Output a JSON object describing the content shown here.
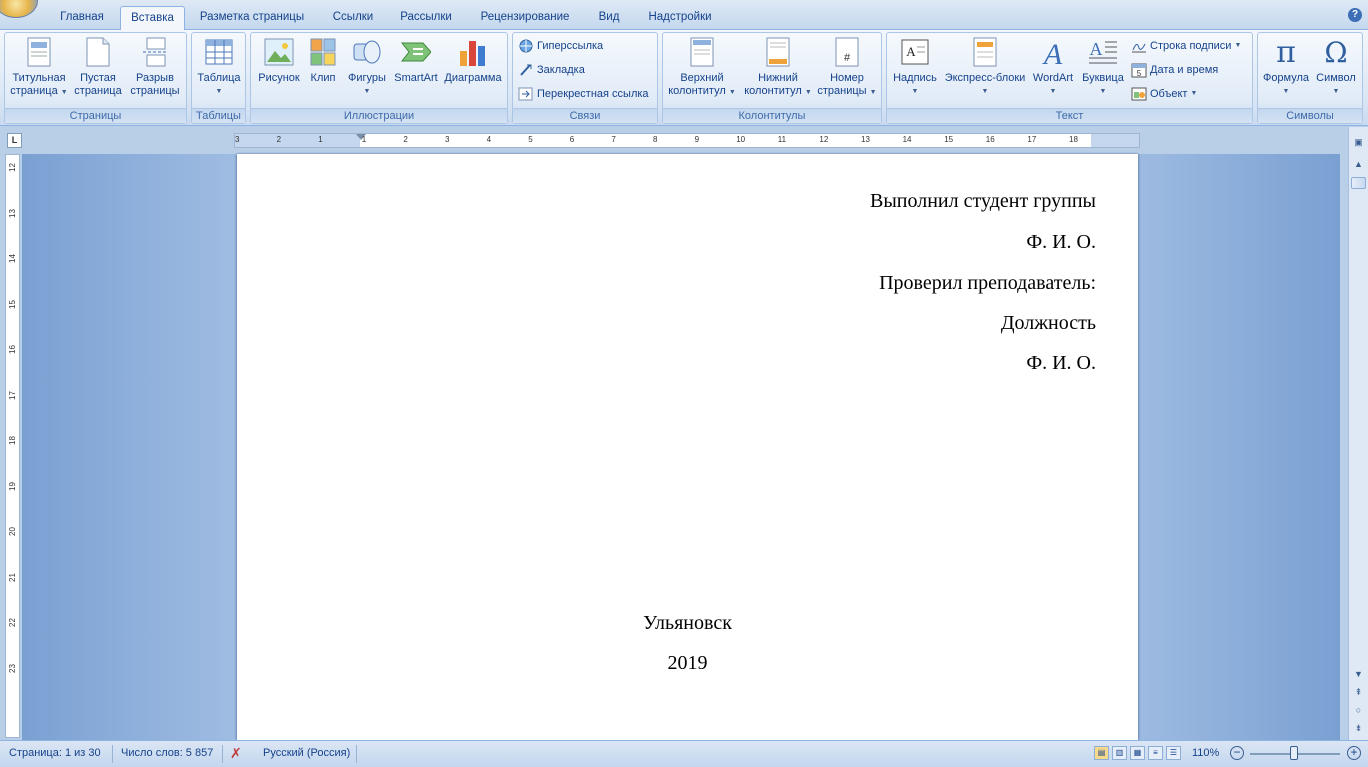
{
  "tabs": [
    "Главная",
    "Вставка",
    "Разметка страницы",
    "Ссылки",
    "Рассылки",
    "Рецензирование",
    "Вид",
    "Надстройки"
  ],
  "active_tab": "Вставка",
  "ribbon": {
    "pages": {
      "label": "Страницы",
      "cover": [
        "Титульная",
        "страница"
      ],
      "blank": [
        "Пустая",
        "страница"
      ],
      "break": [
        "Разрыв",
        "страницы"
      ]
    },
    "tables": {
      "label": "Таблицы",
      "table": "Таблица"
    },
    "illustrations": {
      "label": "Иллюстрации",
      "picture": "Рисунок",
      "clip": "Клип",
      "shapes": "Фигуры",
      "smartart": "SmartArt",
      "chart": "Диаграмма"
    },
    "links": {
      "label": "Связи",
      "hyperlink": "Гиперссылка",
      "bookmark": "Закладка",
      "crossref": "Перекрестная ссылка"
    },
    "headerfooter": {
      "label": "Колонтитулы",
      "header": [
        "Верхний",
        "колонтитул"
      ],
      "footer": [
        "Нижний",
        "колонтитул"
      ],
      "pagenum": [
        "Номер",
        "страницы"
      ]
    },
    "text": {
      "label": "Текст",
      "textbox": "Надпись",
      "quickparts": "Экспресс-блоки",
      "wordart": "WordArt",
      "dropcap": "Буквица",
      "signature": "Строка подписи",
      "datetime": "Дата и время",
      "object": "Объект"
    },
    "symbols": {
      "label": "Символы",
      "equation": "Формула",
      "symbol": "Символ"
    }
  },
  "ruler": {
    "h": [
      "3",
      "2",
      "1",
      "1",
      "2",
      "3",
      "4",
      "5",
      "6",
      "7",
      "8",
      "9",
      "10",
      "11",
      "12",
      "13",
      "14",
      "15",
      "16",
      "17",
      "18"
    ],
    "v": [
      "12",
      "13",
      "14",
      "15",
      "16",
      "17",
      "18",
      "19",
      "20",
      "21",
      "22",
      "23"
    ]
  },
  "document": {
    "right_lines": [
      "Выполнил студент группы",
      "Ф. И. О.",
      "Проверил преподаватель:",
      "Должность",
      "Ф. И. О."
    ],
    "city": "Ульяновск",
    "year": "2019"
  },
  "status": {
    "page": "Страница: 1 из 30",
    "words": "Число слов: 5 857",
    "language": "Русский (Россия)",
    "zoom": "110%",
    "zoom_level": 110
  }
}
